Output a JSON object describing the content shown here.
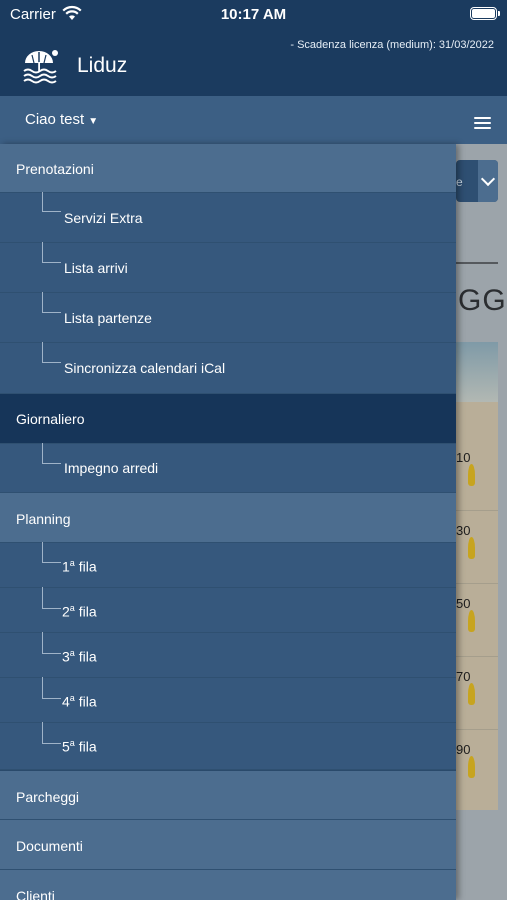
{
  "status_bar": {
    "carrier": "Carrier",
    "time": "10:17 AM"
  },
  "header": {
    "app_name": "Liduz",
    "license_notice": "- Scadenza licenza (medium): 31/03/2022",
    "logo_icon": "beach-umbrella-icon"
  },
  "user_bar": {
    "greeting": "Ciao test",
    "menu_icon": "hamburger-menu-icon"
  },
  "menu": {
    "prenotazioni": {
      "label": "Prenotazioni",
      "items": [
        "Servizi Extra",
        "Lista arrivi",
        "Lista partenze",
        "Sincronizza calendari iCal"
      ]
    },
    "giornaliero": {
      "label": "Giornaliero",
      "items": [
        "Impegno arredi"
      ]
    },
    "planning": {
      "label": "Planning",
      "rows": [
        {
          "num": "1",
          "sup": "a",
          "suffix": " fila"
        },
        {
          "num": "2",
          "sup": "a",
          "suffix": " fila"
        },
        {
          "num": "3",
          "sup": "a",
          "suffix": " fila"
        },
        {
          "num": "4",
          "sup": "a",
          "suffix": " fila"
        },
        {
          "num": "5",
          "sup": "a",
          "suffix": " fila"
        }
      ]
    },
    "parcheggi": {
      "label": "Parcheggi"
    },
    "documenti": {
      "label": "Documenti"
    },
    "clienti": {
      "label": "Clienti"
    }
  },
  "background_page": {
    "dropdown_text": "e",
    "heading": "GGI",
    "slots": [
      "10",
      "30",
      "50",
      "70",
      "90"
    ]
  },
  "colors": {
    "header_bg": "#1b3b5f",
    "user_bar_bg": "#3c5f84",
    "menu_head_bg": "#4c6d8f",
    "menu_active_bg": "#163559",
    "submenu_bg": "#36587d",
    "umbrella": "#c7a41f"
  }
}
